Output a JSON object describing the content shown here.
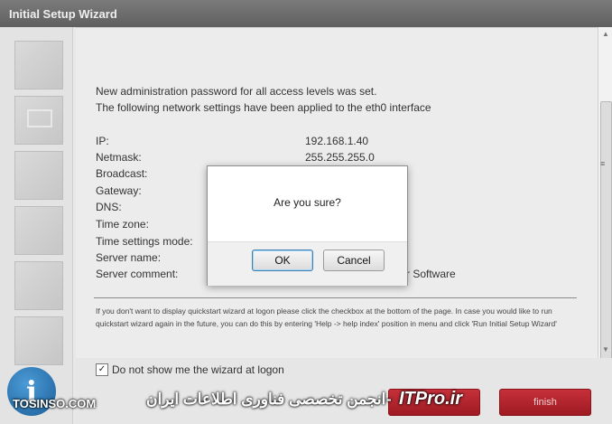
{
  "window": {
    "title": "Initial Setup Wizard"
  },
  "content": {
    "intro_lines": [
      "New administration password for all access levels was set.",
      "The following network settings have been applied to the eth0 interface"
    ],
    "settings": [
      {
        "label": "IP:",
        "value": "192.168.1.40"
      },
      {
        "label": "Netmask:",
        "value": "255.255.255.0"
      },
      {
        "label": "Broadcast:",
        "value": ""
      },
      {
        "label": "Gateway:",
        "value": ""
      },
      {
        "label": "DNS:",
        "value": ""
      },
      {
        "label": "Time zone:",
        "value": ""
      },
      {
        "label": "Time settings mode:",
        "value": ""
      },
      {
        "label": "Server name:",
        "value": ""
      },
      {
        "label": "Server comment:",
        "value": "r Software"
      }
    ],
    "note": "If you don't want to display quickstart wizard at logon please click the checkbox at the bottom of the page. In case you would like to run quickstart wizard again in the future, you can do this by entering 'Help -> help index' position in menu and click 'Run Initial Setup Wizard'",
    "checkbox_label": "Do not show me the wizard at logon",
    "checkbox_checked": true
  },
  "footer": {
    "finish_label": "finish"
  },
  "dialog": {
    "message": "Are you sure?",
    "ok_label": "OK",
    "cancel_label": "Cancel"
  },
  "watermark": {
    "site": "TOSINSO.COM",
    "tagline": "انجمن تخصصی فناوری اطلاعات ایران",
    "dash": "-",
    "brand": "ITPro.ir"
  },
  "icons": {
    "info": "info-icon",
    "checkmark": "✓"
  }
}
